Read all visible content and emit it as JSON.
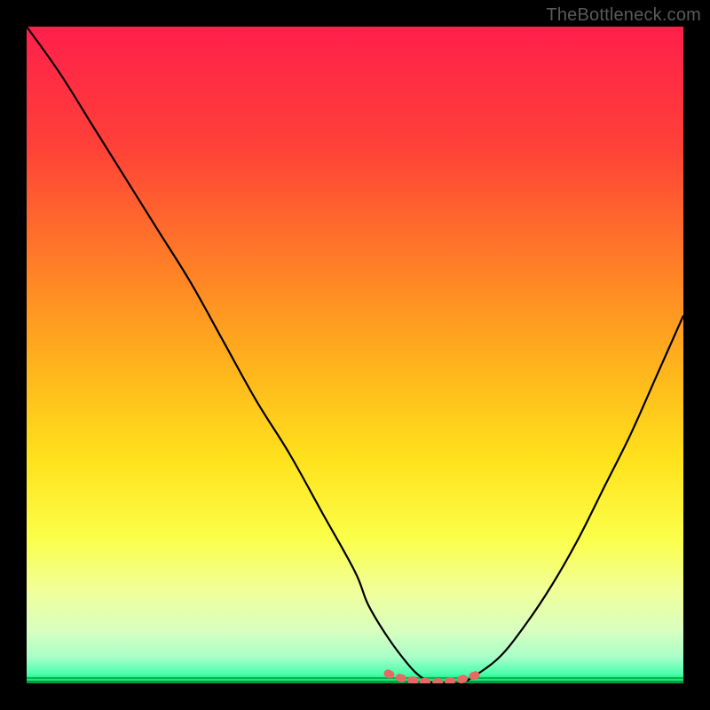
{
  "watermark": "TheBottleneck.com",
  "chart_data": {
    "type": "line",
    "title": "",
    "xlabel": "",
    "ylabel": "",
    "xlim": [
      0,
      100
    ],
    "ylim": [
      0,
      100
    ],
    "grid": false,
    "legend": false,
    "series": [
      {
        "name": "bottleneck-curve",
        "x": [
          0,
          5,
          10,
          15,
          20,
          25,
          30,
          35,
          40,
          45,
          50,
          52,
          55,
          58,
          60,
          62,
          64,
          66,
          68,
          72,
          76,
          80,
          84,
          88,
          92,
          96,
          100
        ],
        "y": [
          100,
          93,
          85,
          77,
          69,
          61,
          52,
          43,
          35,
          26,
          17,
          12,
          7,
          3,
          1,
          0,
          0,
          0,
          1,
          4,
          9,
          15,
          22,
          30,
          38,
          47,
          56
        ]
      },
      {
        "name": "optimal-zone-marker",
        "x": [
          55,
          57,
          59,
          61,
          63,
          65,
          67,
          69
        ],
        "y": [
          1.5,
          0.8,
          0.4,
          0.2,
          0.2,
          0.4,
          0.8,
          1.5
        ]
      }
    ],
    "gradient_colors": {
      "top": "#ff1f4b",
      "mid_upper": "#ff6a2a",
      "mid": "#ffd21a",
      "mid_lower": "#faff66",
      "lower": "#c9ffb0",
      "bottom_edge": "#00e676",
      "bottom_line": "#00c853"
    },
    "marker_color": "#e66a64"
  }
}
